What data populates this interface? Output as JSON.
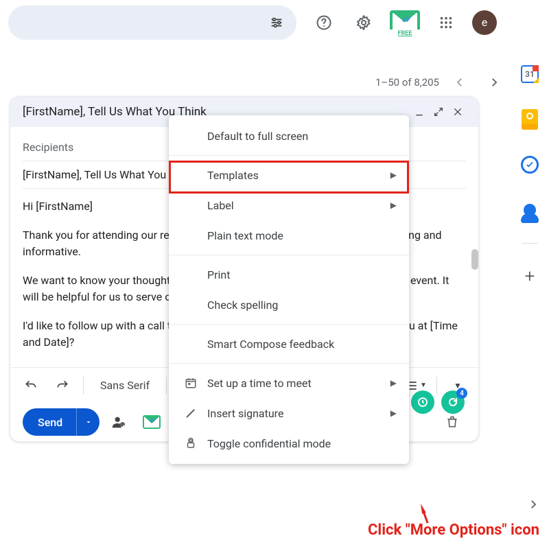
{
  "top": {
    "avatar_initial": "e",
    "mailtrack_tag": "FREE"
  },
  "pagination": {
    "range": "1–50 of 8,205"
  },
  "compose": {
    "title": "[FirstName], Tell Us What You Think",
    "recipients_placeholder": "Recipients",
    "subject": "[FirstName], Tell Us What You Think",
    "body": {
      "greeting": "Hi [FirstName]",
      "p1": "Thank you for attending our recent [Event Name]. We hope you found it interesting and informative.",
      "p2": "We want to know your thoughts on the product updates we launched during the event. It will be helpful for us to serve our esteemed customers better.",
      "p3": "I'd like to follow up with a call that wouldn't take much of your time. Can I call you at [Time and Date]?"
    },
    "font": "Sans Serif",
    "send_label": "Send"
  },
  "bubbles": {
    "grammarly_badge": "4"
  },
  "menu": {
    "items": [
      {
        "label": "Default to full screen",
        "icon": "",
        "sub": false
      },
      {
        "label": "Templates",
        "icon": "",
        "sub": true
      },
      {
        "label": "Label",
        "icon": "",
        "sub": true
      },
      {
        "label": "Plain text mode",
        "icon": "",
        "sub": false
      },
      {
        "label": "Print",
        "icon": "",
        "sub": false
      },
      {
        "label": "Check spelling",
        "icon": "",
        "sub": false
      },
      {
        "label": "Smart Compose feedback",
        "icon": "",
        "sub": false
      },
      {
        "label": "Set up a time to meet",
        "icon": "calendar",
        "sub": true
      },
      {
        "label": "Insert signature",
        "icon": "pen",
        "sub": true
      },
      {
        "label": "Toggle confidential mode",
        "icon": "lock",
        "sub": false
      }
    ]
  },
  "side": {
    "calendar_day": "31"
  },
  "annotation": {
    "text": "Click \"More Options\" icon"
  }
}
